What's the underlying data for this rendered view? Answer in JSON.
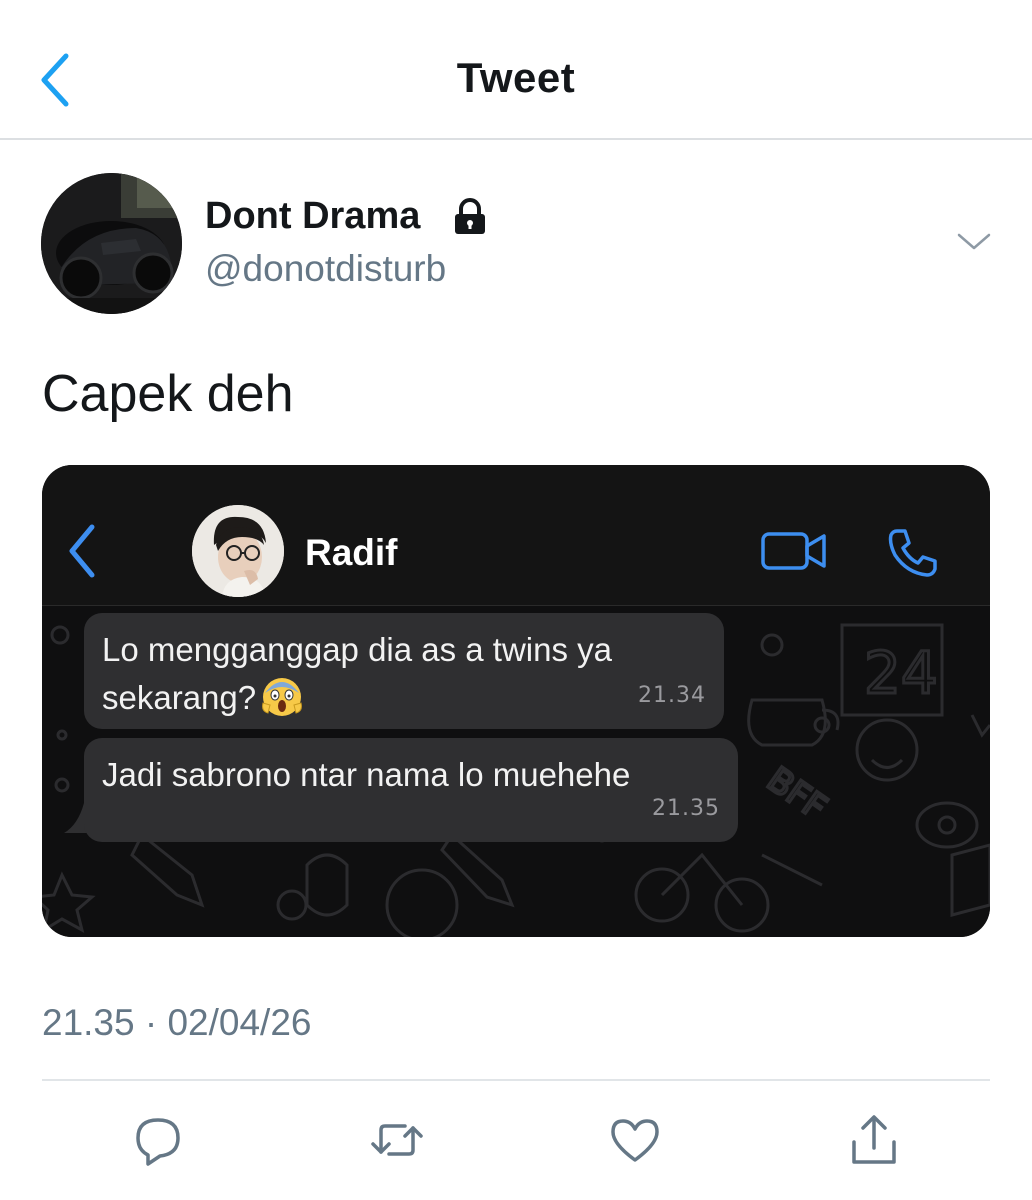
{
  "nav": {
    "title": "Tweet"
  },
  "author": {
    "display_name": "Dont Drama",
    "handle": "@donotdisturb",
    "protected": true
  },
  "tweet": {
    "text": "Capek deh",
    "timestamp": "21.35 · 02/04/26"
  },
  "media": {
    "chat_contact_name": "Radif",
    "messages": [
      {
        "line1": "Lo mengganggap dia as a twins ya",
        "line2": "sekarang?",
        "emoji": "face-screaming-in-fear",
        "time": "21.34"
      },
      {
        "text": "Jadi sabrono ntar nama lo muehehe",
        "time": "21.35"
      }
    ],
    "accent_color": "#3d8ef0"
  },
  "actions": [
    "reply-icon",
    "retweet-icon",
    "like-icon",
    "share-icon"
  ],
  "colors": {
    "accent": "#1da1f2",
    "secondary_text": "#657786",
    "divider": "#e1e5e8"
  }
}
